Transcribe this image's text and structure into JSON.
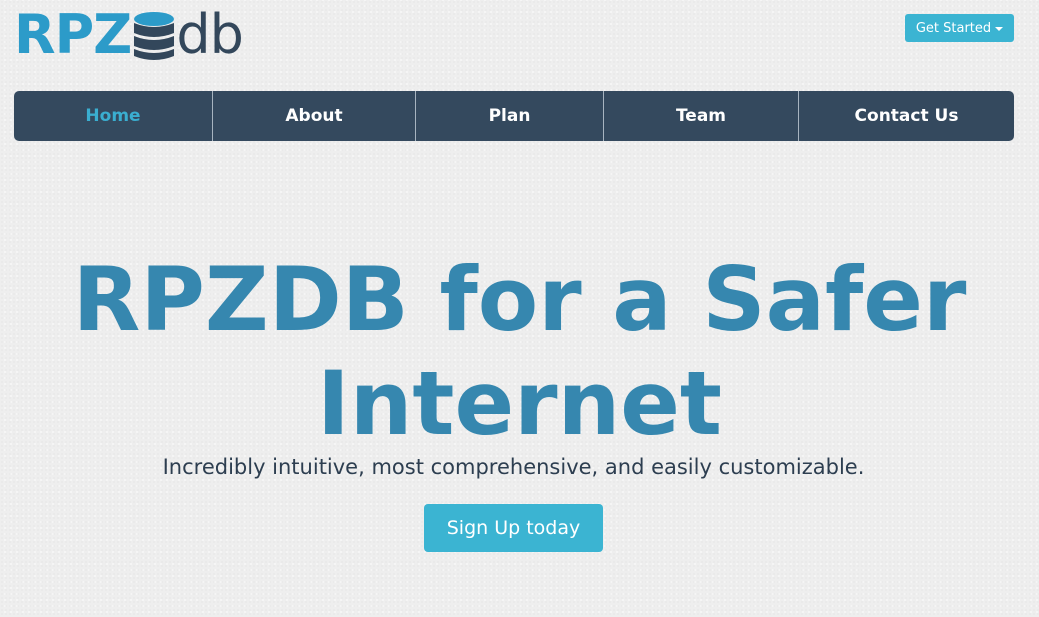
{
  "header": {
    "logo": {
      "text_left": "RPZ",
      "text_right": "db",
      "icon": "database-icon",
      "color_left": "#2c9bc9",
      "color_right": "#33475b"
    },
    "get_started": {
      "label": "Get Started",
      "icon": "caret-down-icon"
    }
  },
  "nav": {
    "items": [
      {
        "label": "Home",
        "active": true
      },
      {
        "label": "About",
        "active": false
      },
      {
        "label": "Plan",
        "active": false
      },
      {
        "label": "Team",
        "active": false
      },
      {
        "label": "Contact Us",
        "active": false
      }
    ]
  },
  "hero": {
    "title": "RPZDB for a Safer Internet",
    "subtitle": "Incredibly intuitive, most comprehensive, and easily customizable.",
    "cta_label": "Sign Up today"
  },
  "colors": {
    "background": "#eeeeee",
    "navbar": "#34495e",
    "accent": "#3bb4d2",
    "active_nav": "#3aaed0",
    "hero_title": "#3687af",
    "subtitle": "#2d3e50"
  }
}
